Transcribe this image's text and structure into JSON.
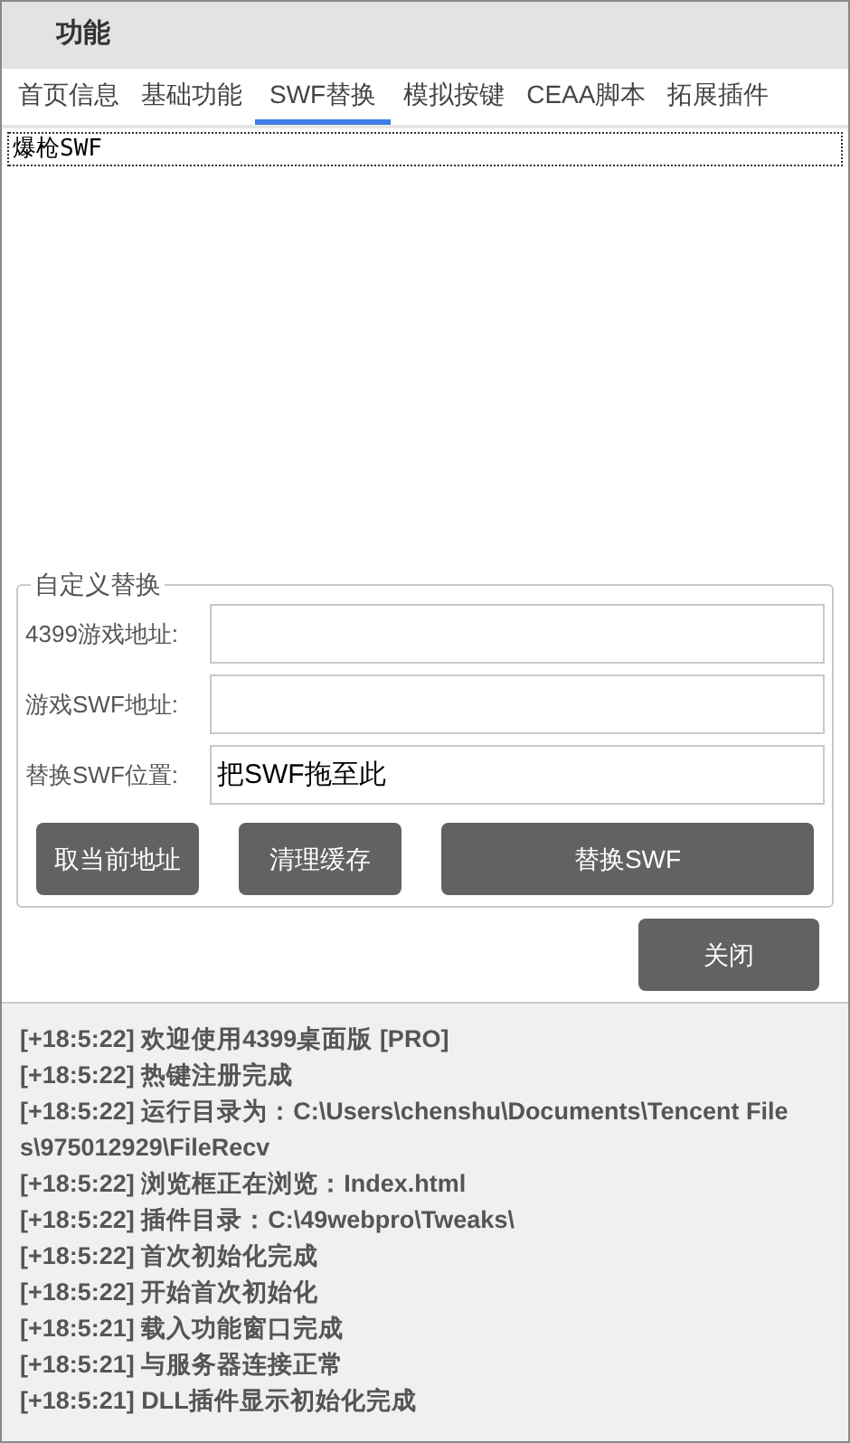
{
  "window": {
    "title": "功能"
  },
  "tabs": [
    {
      "label": "首页信息",
      "selected": false
    },
    {
      "label": "基础功能",
      "selected": false
    },
    {
      "label": "SWF替换",
      "selected": true
    },
    {
      "label": "模拟按键",
      "selected": false
    },
    {
      "label": "CEAA脚本",
      "selected": false
    },
    {
      "label": "拓展插件",
      "selected": false
    }
  ],
  "swf_list": {
    "items": [
      {
        "label": "爆枪SWF",
        "selected": true
      }
    ]
  },
  "custom_replace": {
    "title": "自定义替换",
    "fields": [
      {
        "label": "4399游戏地址:"
      },
      {
        "label": "游戏SWF地址:"
      },
      {
        "label": "替换SWF位置:",
        "value": "把SWF拖至此"
      }
    ],
    "buttons": [
      "取当前地址",
      "清理缓存",
      "替换SWF"
    ]
  },
  "close_button": "关闭",
  "log": [
    "[+18:5:22] 欢迎使用4399桌面版 [PRO]",
    "[+18:5:22] 热键注册完成",
    "[+18:5:22] 运行目录为：C:\\Users\\chenshu\\Documents\\Tencent Files\\975012929\\FileRecv",
    "[+18:5:22] 浏览框正在浏览：Index.html",
    "[+18:5:22] 插件目录：C:\\49webpro\\Tweaks\\",
    "[+18:5:22] 首次初始化完成",
    "[+18:5:22] 开始首次初始化",
    "[+18:5:21] 载入功能窗口完成",
    "[+18:5:21] 与服务器连接正常",
    "[+18:5:21] DLL插件显示初始化完成"
  ]
}
